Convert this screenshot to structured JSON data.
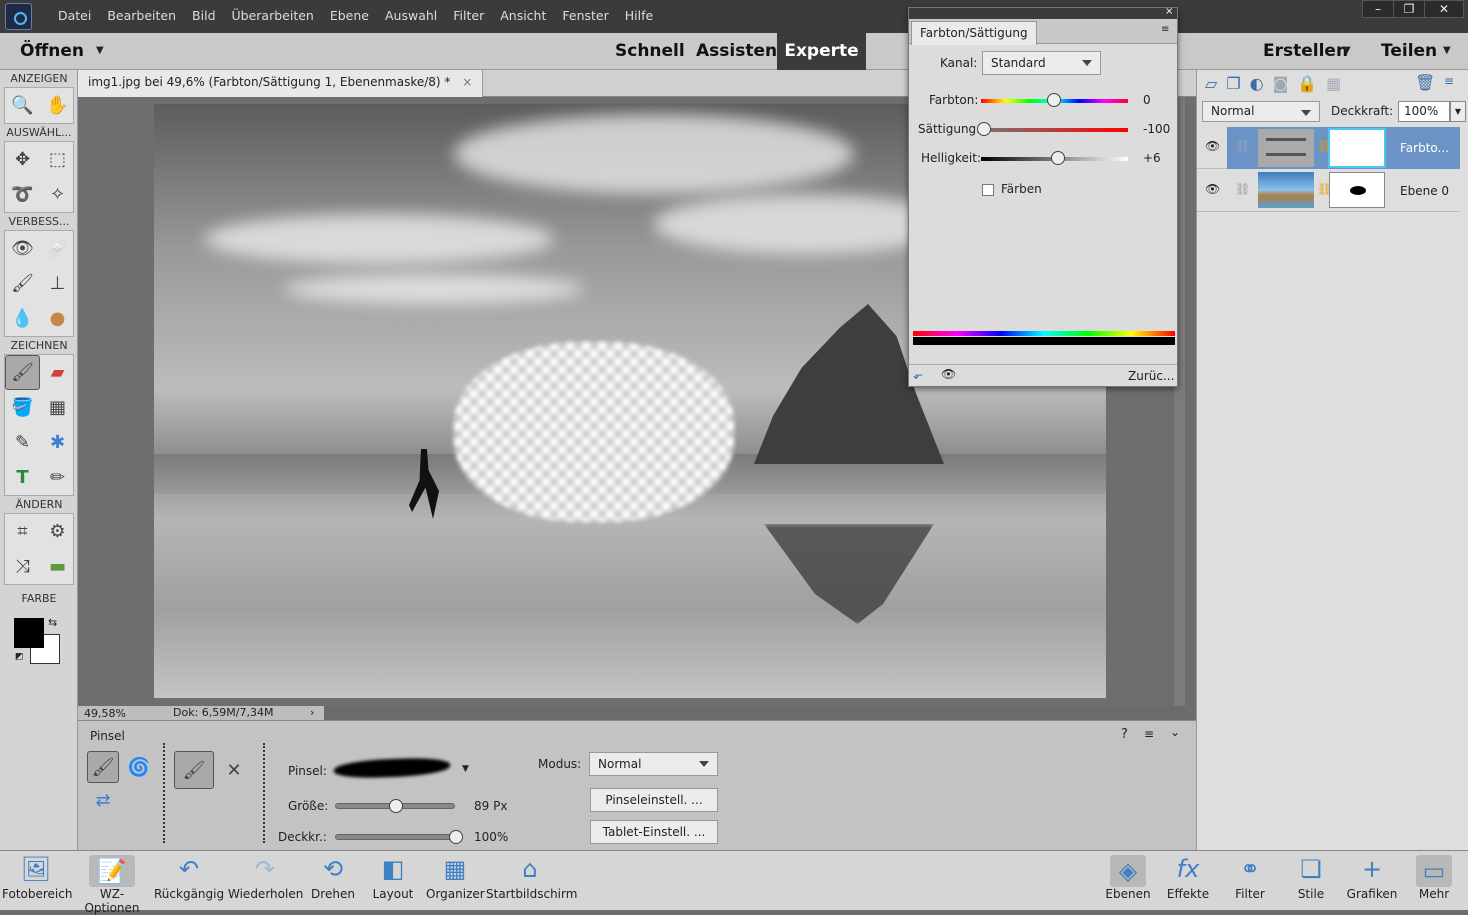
{
  "menubar": {
    "items": [
      "Datei",
      "Bearbeiten",
      "Bild",
      "Überarbeiten",
      "Ebene",
      "Auswahl",
      "Filter",
      "Ansicht",
      "Fenster",
      "Hilfe"
    ]
  },
  "modebar": {
    "open": "Öffnen",
    "modes": [
      "Schnell",
      "Assistent",
      "Experte"
    ],
    "active": "Experte",
    "create": "Erstellen",
    "share": "Teilen"
  },
  "toolbar": {
    "sections": [
      "ANZEIGEN",
      "AUSWÄHL...",
      "VERBESS...",
      "ZEICHNEN",
      "ÄNDERN",
      "FARBE"
    ],
    "foreground": "#000000",
    "background": "#ffffff"
  },
  "document": {
    "tab": "img1.jpg bei 49,6% (Farbton/Sättigung 1, Ebenenmaske/8) *",
    "zoom": "49,58%",
    "doc_size": "Dok: 6,59M/7,34M"
  },
  "options": {
    "title": "Pinsel",
    "brush_label": "Pinsel:",
    "size_label": "Größe:",
    "size_value": "89 Px",
    "size_fraction": 0.5,
    "opacity_label": "Deckkr.:",
    "opacity_value": "100%",
    "opacity_fraction": 1.0,
    "mode_label": "Modus:",
    "mode_value": "Normal",
    "brush_settings": "Pinseleinstell. ...",
    "tablet_settings": "Tablet-Einstell. ..."
  },
  "hue_panel": {
    "title": "Farbton/Sättigung",
    "channel_label": "Kanal:",
    "channel_value": "Standard",
    "hue_label": "Farbton:",
    "hue_value": "0",
    "saturation_label": "Sättigung:",
    "saturation_value": "-100",
    "lightness_label": "Helligkeit:",
    "lightness_value": "+6",
    "colorize_label": "Färben",
    "colorize_checked": false,
    "reset": "Zurüc..."
  },
  "layers": {
    "blend_mode": "Normal",
    "opacity_label": "Deckkraft:",
    "opacity_value": "100%",
    "items": [
      {
        "name": "Farbto...",
        "selected": true
      },
      {
        "name": "Ebene 0",
        "selected": false
      }
    ]
  },
  "bottombar": {
    "left": [
      "Fotobereich",
      "WZ-Optionen",
      "Rückgängig",
      "Wiederholen",
      "Drehen",
      "Layout",
      "Organizer",
      "Startbildschirm"
    ],
    "right": [
      "Ebenen",
      "Effekte",
      "Filter",
      "Stile",
      "Grafiken",
      "Mehr"
    ]
  }
}
